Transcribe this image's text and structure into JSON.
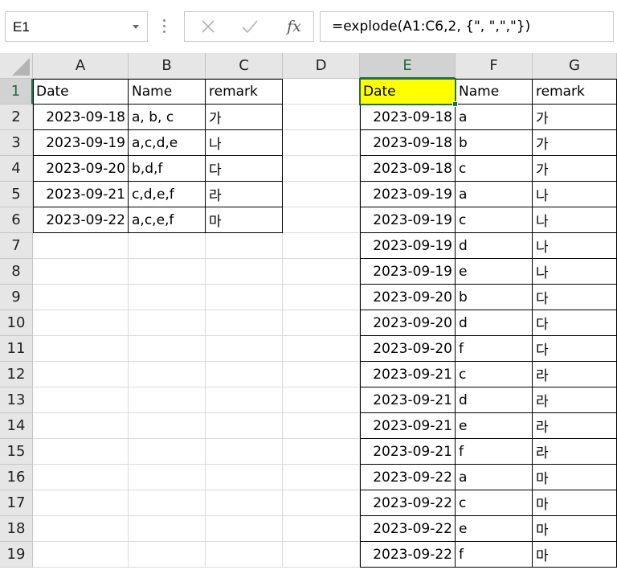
{
  "formula_bar": {
    "name_box": "E1",
    "cancel_icon": "close-icon",
    "enter_icon": "check-icon",
    "fx_label": "fx",
    "formula": "=explode(A1:C6,2, {\", \",\",\"})"
  },
  "columns": [
    "A",
    "B",
    "C",
    "D",
    "E",
    "F",
    "G"
  ],
  "rows": [
    "1",
    "2",
    "3",
    "4",
    "5",
    "6",
    "7",
    "8",
    "9",
    "10",
    "11",
    "12",
    "13",
    "14",
    "15",
    "16",
    "17",
    "18",
    "19"
  ],
  "selected_cell": "E1",
  "source_table": {
    "headers": [
      "Date",
      "Name",
      "remark"
    ],
    "rows": [
      [
        "2023-09-18",
        "a, b, c",
        "가"
      ],
      [
        "2023-09-19",
        "a,c,d,e",
        "나"
      ],
      [
        "2023-09-20",
        "b,d,f",
        "다"
      ],
      [
        "2023-09-21",
        "c,d,e,f",
        "라"
      ],
      [
        "2023-09-22",
        "a,c,e,f",
        "마"
      ]
    ]
  },
  "result_table": {
    "headers": [
      "Date",
      "Name",
      "remark"
    ],
    "header_highlight": "#ffff00",
    "rows": [
      [
        "2023-09-18",
        "a",
        "가"
      ],
      [
        "2023-09-18",
        "b",
        "가"
      ],
      [
        "2023-09-18",
        "c",
        "가"
      ],
      [
        "2023-09-19",
        "a",
        "나"
      ],
      [
        "2023-09-19",
        "c",
        "나"
      ],
      [
        "2023-09-19",
        "d",
        "나"
      ],
      [
        "2023-09-19",
        "e",
        "나"
      ],
      [
        "2023-09-20",
        "b",
        "다"
      ],
      [
        "2023-09-20",
        "d",
        "다"
      ],
      [
        "2023-09-20",
        "f",
        "다"
      ],
      [
        "2023-09-21",
        "c",
        "라"
      ],
      [
        "2023-09-21",
        "d",
        "라"
      ],
      [
        "2023-09-21",
        "e",
        "라"
      ],
      [
        "2023-09-21",
        "f",
        "라"
      ],
      [
        "2023-09-22",
        "a",
        "마"
      ],
      [
        "2023-09-22",
        "c",
        "마"
      ],
      [
        "2023-09-22",
        "e",
        "마"
      ],
      [
        "2023-09-22",
        "f",
        "마"
      ]
    ]
  },
  "colors": {
    "accent": "#1f7244",
    "header_bg": "#e6e6e6",
    "selected_header_bg": "#d2d2d2"
  }
}
